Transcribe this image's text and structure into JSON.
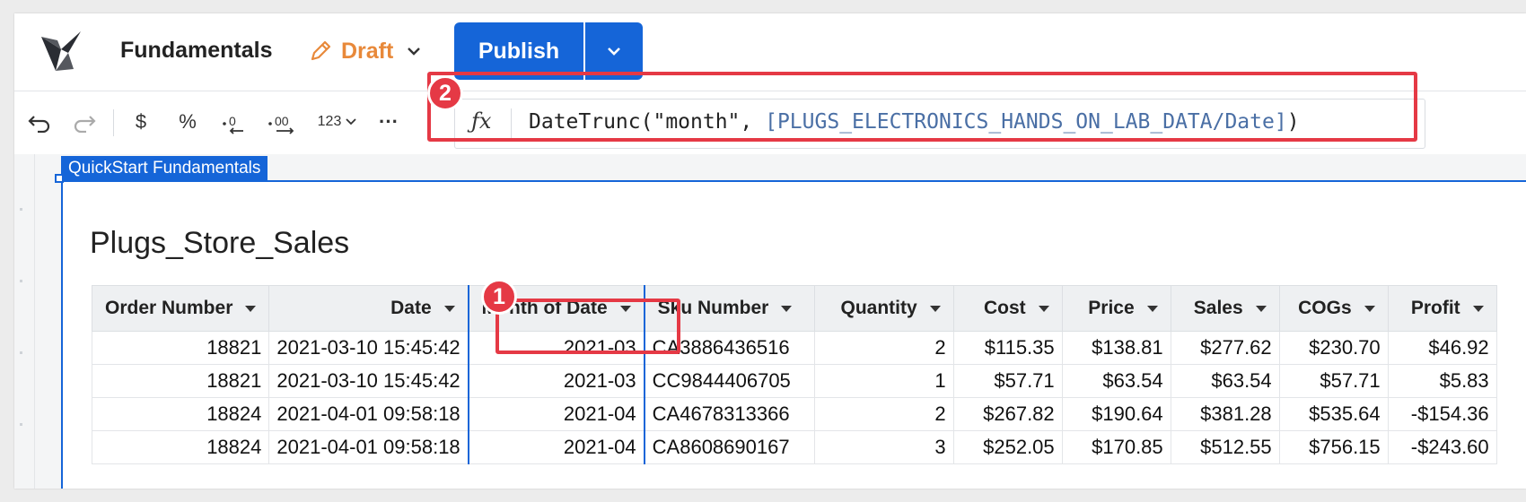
{
  "header": {
    "app_title": "Fundamentals",
    "draft_label": "Draft",
    "publish_label": "Publish"
  },
  "toolbar": {
    "icons": [
      "undo-icon",
      "redo-icon",
      "currency-icon",
      "percent-icon",
      "decrease-decimals-icon",
      "increase-decimals-icon",
      "number-format-icon",
      "more-icon"
    ],
    "currency_label": "$",
    "percent_label": "%",
    "number_format_label": "123",
    "more_label": "···"
  },
  "formula": {
    "prefix": "DateTrunc(\"month\", ",
    "reference": "[PLUGS_ELECTRONICS_HANDS_ON_LAB_DATA/Date]",
    "suffix": ")"
  },
  "annotations": {
    "badge1": "1",
    "badge2": "2",
    "color": "#e53945"
  },
  "page": {
    "tab_label": "QuickStart Fundamentals",
    "table_title": "Plugs_Store_Sales"
  },
  "table": {
    "columns": [
      "Order Number",
      "Date",
      "Month of Date",
      "Sku Number",
      "Quantity",
      "Cost",
      "Price",
      "Sales",
      "COGs",
      "Profit"
    ],
    "rows": [
      [
        "18821",
        "2021-03-10 15:45:42",
        "2021-03",
        "CA3886436516",
        "2",
        "$115.35",
        "$138.81",
        "$277.62",
        "$230.70",
        "$46.92"
      ],
      [
        "18821",
        "2021-03-10 15:45:42",
        "2021-03",
        "CC9844406705",
        "1",
        "$57.71",
        "$63.54",
        "$63.54",
        "$57.71",
        "$5.83"
      ],
      [
        "18824",
        "2021-04-01 09:58:18",
        "2021-04",
        "CA4678313366",
        "2",
        "$267.82",
        "$190.64",
        "$381.28",
        "$535.64",
        "-$154.36"
      ],
      [
        "18824",
        "2021-04-01 09:58:18",
        "2021-04",
        "CA8608690167",
        "3",
        "$252.05",
        "$170.85",
        "$512.55",
        "$756.15",
        "-$243.60"
      ]
    ]
  },
  "colors": {
    "accent": "#1565d8",
    "draft": "#e8893a",
    "highlight": "#e53945"
  }
}
